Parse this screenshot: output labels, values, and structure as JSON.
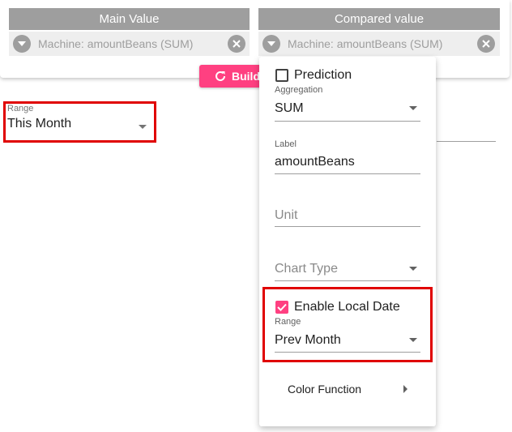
{
  "header": {
    "main_value": {
      "title": "Main Value",
      "chip_text": "Machine: amountBeans (SUM)"
    },
    "compared_value": {
      "title": "Compared value",
      "chip_text": "Machine: amountBeans (SUM)"
    }
  },
  "build_button": {
    "label": "Build"
  },
  "range_field": {
    "label": "Range",
    "value": "This Month"
  },
  "popup": {
    "prediction": {
      "label": "Prediction",
      "checked": false
    },
    "aggregation": {
      "label": "Aggregation",
      "value": "SUM"
    },
    "label_field": {
      "label": "Label",
      "value": "amountBeans"
    },
    "unit_field": {
      "placeholder": "Unit"
    },
    "chart_type": {
      "placeholder": "Chart Type"
    },
    "enable_local_date": {
      "label": "Enable Local Date",
      "checked": true
    },
    "local_range": {
      "label": "Range",
      "value": "Prev Month"
    },
    "color_function": {
      "label": "Color Function"
    }
  },
  "colors": {
    "accent": "#ff4081",
    "highlight": "#e00000",
    "header_grey": "#9e9e9e",
    "chip_bg": "#eeeeee"
  }
}
